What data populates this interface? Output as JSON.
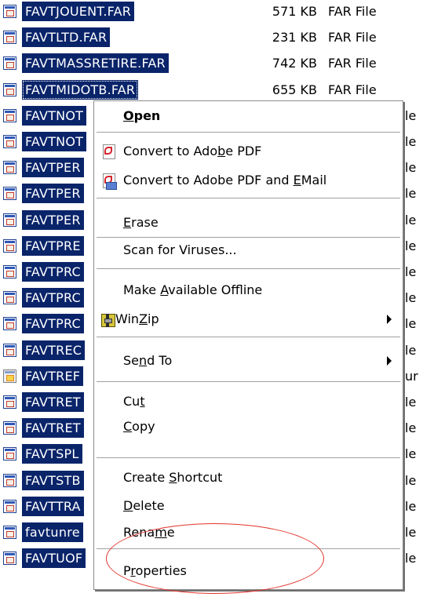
{
  "files": [
    {
      "name": "FAVTJOUENT.FAR",
      "size": "571 KB",
      "type": "FAR File",
      "icon": "far-file-icon"
    },
    {
      "name": "FAVTLTD.FAR",
      "size": "231 KB",
      "type": "FAR File",
      "icon": "far-file-icon"
    },
    {
      "name": "FAVTMASSRETIRE.FAR",
      "size": "742 KB",
      "type": "FAR File",
      "icon": "far-file-icon"
    },
    {
      "name": "FAVTMIDOTB.FAR",
      "size": "655 KB",
      "type": "FAR File",
      "icon": "far-file-icon"
    },
    {
      "name": "FAVTNOT",
      "size": "",
      "type": "le",
      "icon": "far-file-icon"
    },
    {
      "name": "FAVTNOT",
      "size": "",
      "type": "le",
      "icon": "far-file-icon"
    },
    {
      "name": "FAVTPER",
      "size": "",
      "type": "le",
      "icon": "far-file-icon"
    },
    {
      "name": "FAVTPER",
      "size": "",
      "type": "le",
      "icon": "far-file-icon"
    },
    {
      "name": "FAVTPER",
      "size": "",
      "type": "le",
      "icon": "far-file-icon"
    },
    {
      "name": "FAVTPRE",
      "size": "",
      "type": "le",
      "icon": "far-file-icon"
    },
    {
      "name": "FAVTPRC",
      "size": "",
      "type": "le",
      "icon": "far-file-icon"
    },
    {
      "name": "FAVTPRC",
      "size": "",
      "type": "le",
      "icon": "far-file-icon"
    },
    {
      "name": "FAVTPRC",
      "size": "",
      "type": "le",
      "icon": "far-file-icon"
    },
    {
      "name": "FAVTREC",
      "size": "",
      "type": "le",
      "icon": "far-file-icon"
    },
    {
      "name": "FAVTREF",
      "size": "",
      "type": "ur",
      "icon": "shortcut-file-icon"
    },
    {
      "name": "FAVTRET",
      "size": "",
      "type": "le",
      "icon": "far-file-icon"
    },
    {
      "name": "FAVTRET",
      "size": "",
      "type": "le",
      "icon": "far-file-icon"
    },
    {
      "name": "FAVTSPL",
      "size": "",
      "type": "le",
      "icon": "far-file-icon"
    },
    {
      "name": "FAVTSTB",
      "size": "",
      "type": "le",
      "icon": "far-file-icon"
    },
    {
      "name": "FAVTTRA",
      "size": "",
      "type": "le",
      "icon": "far-file-icon"
    },
    {
      "name": "favtunre",
      "size": "",
      "type": "le",
      "icon": "far-file-icon"
    },
    {
      "name": "FAVTUOF",
      "size": "",
      "type": "le",
      "icon": "far-file-icon"
    }
  ],
  "menu": {
    "open": {
      "pre": "",
      "key": "O",
      "post": "pen"
    },
    "convert_pdf": {
      "pre": "Convert to Ado",
      "key": "b",
      "post": "e PDF",
      "icon": "adobe-pdf-icon"
    },
    "convert_pdf_email": {
      "pre": "Convert to Adobe PDF and ",
      "key": "E",
      "post": "Mail",
      "icon": "adobe-pdf-email-icon"
    },
    "erase": {
      "pre": "",
      "key": "E",
      "post": "rase"
    },
    "scan": {
      "pre": "Scan for Viruses...",
      "key": "",
      "post": ""
    },
    "offline": {
      "pre": "Make ",
      "key": "A",
      "post": "vailable Offline"
    },
    "winzip": {
      "pre": "Win",
      "key": "Z",
      "post": "ip",
      "icon": "winzip-icon"
    },
    "send_to": {
      "pre": "Se",
      "key": "n",
      "post": "d To"
    },
    "cut": {
      "pre": "Cu",
      "key": "t",
      "post": ""
    },
    "copy": {
      "pre": "",
      "key": "C",
      "post": "opy"
    },
    "shortcut": {
      "pre": "Create ",
      "key": "S",
      "post": "hortcut"
    },
    "delete": {
      "pre": "",
      "key": "D",
      "post": "elete"
    },
    "rename": {
      "pre": "Rena",
      "key": "m",
      "post": "e"
    },
    "properties": {
      "pre": "P",
      "key": "r",
      "post": "operties"
    }
  },
  "colors": {
    "selection": "#0a246a",
    "annotation": "#e2332b"
  }
}
